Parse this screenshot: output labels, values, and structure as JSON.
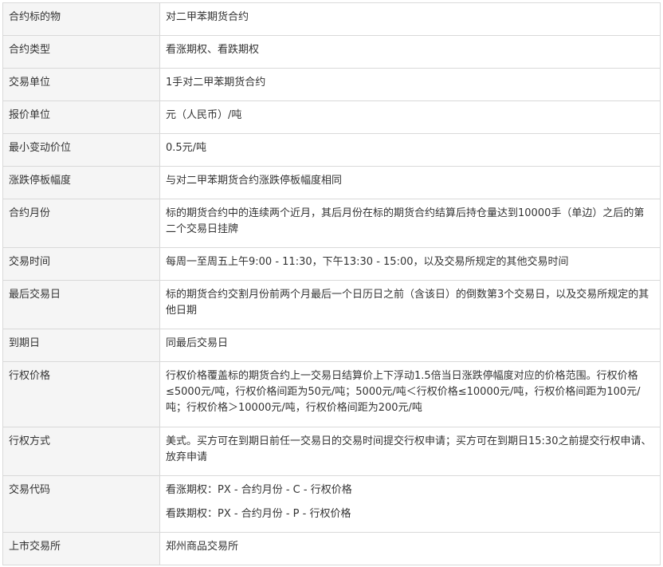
{
  "rows": [
    {
      "label": "合约标的物",
      "value": "对二甲苯期货合约"
    },
    {
      "label": "合约类型",
      "value": "看涨期权、看跌期权"
    },
    {
      "label": "交易单位",
      "value": "1手对二甲苯期货合约"
    },
    {
      "label": "报价单位",
      "value": "元（人民币）/吨"
    },
    {
      "label": "最小变动价位",
      "value": "0.5元/吨"
    },
    {
      "label": "涨跌停板幅度",
      "value": "与对二甲苯期货合约涨跌停板幅度相同"
    },
    {
      "label": "合约月份",
      "value": "标的期货合约中的连续两个近月，其后月份在标的期货合约结算后持仓量达到10000手（单边）之后的第二个交易日挂牌"
    },
    {
      "label": "交易时间",
      "value": "每周一至周五上午9:00 - 11:30，下午13:30 - 15:00，以及交易所规定的其他交易时间"
    },
    {
      "label": "最后交易日",
      "value": "标的期货合约交割月份前两个月最后一个日历日之前（含该日）的倒数第3个交易日，以及交易所规定的其他日期"
    },
    {
      "label": "到期日",
      "value": "同最后交易日"
    },
    {
      "label": "行权价格",
      "value": "行权价格覆盖标的期货合约上一交易日结算价上下浮动1.5倍当日涨跌停幅度对应的价格范围。行权价格≤5000元/吨，行权价格间距为50元/吨；5000元/吨＜行权价格≤10000元/吨，行权价格间距为100元/吨；行权价格＞10000元/吨，行权价格间距为200元/吨"
    },
    {
      "label": "行权方式",
      "value": "美式。买方可在到期日前任一交易日的交易时间提交行权申请；买方可在到期日15:30之前提交行权申请、放弃申请"
    },
    {
      "label": "交易代码",
      "value_lines": [
        "看涨期权：PX - 合约月份 - C - 行权价格",
        "看跌期权：PX - 合约月份 - P - 行权价格"
      ]
    },
    {
      "label": "上市交易所",
      "value": "郑州商品交易所"
    }
  ]
}
